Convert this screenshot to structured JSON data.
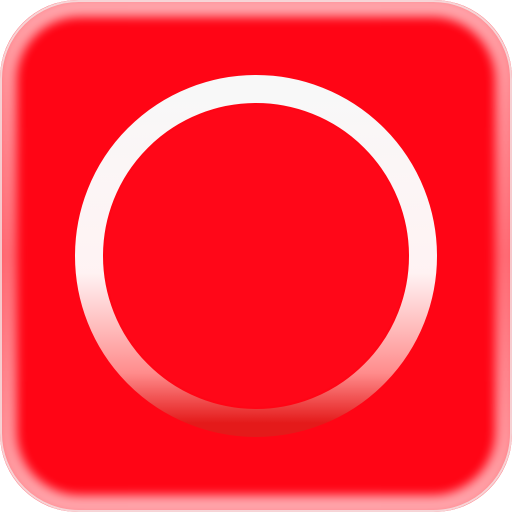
{
  "icon": {
    "name": "record-icon",
    "colors": {
      "tile_fill": "#FF0515",
      "tile_edge_highlight": "#FFFFFF",
      "tile_border": "#F2F2F2",
      "ring_top": "#F8F8F8",
      "ring_bottom": "#E41A1A"
    }
  }
}
